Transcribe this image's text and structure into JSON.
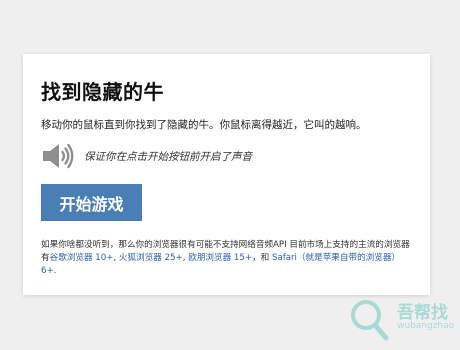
{
  "card": {
    "title": "找到隐藏的牛",
    "subtitle": "移动你的鼠标直到你找到了隐藏的牛。你鼠标离得越近，它叫的越响。",
    "sound_hint": "保证你在点击开始按钮前开启了声音",
    "start_button_label": "开始游戏",
    "note": {
      "text_before": "如果你啥都没听到，那么你的浏览器很有可能不支持网络音频API 目前市场上支持的主流的浏览器有",
      "link_chrome": "谷歌浏览器 10+",
      "sep1": ", ",
      "link_firefox": "火狐浏览器 25+",
      "sep2": ", ",
      "link_opera": "欧朋浏览器 15+",
      "sep3": "，和 ",
      "link_safari": "Safari（就是苹果自带的浏览器） 6+",
      "text_after": "."
    }
  },
  "watermark": {
    "name": "吾帮找",
    "url": "wubangzhao"
  },
  "colors": {
    "background": "#efefef",
    "card": "#ffffff",
    "button": "#4a7fb5",
    "link": "#2b5fb0",
    "watermark": "#2bb3a3"
  },
  "icons": {
    "speaker": "speaker-volume-icon",
    "watermark": "magnifier-icon"
  }
}
